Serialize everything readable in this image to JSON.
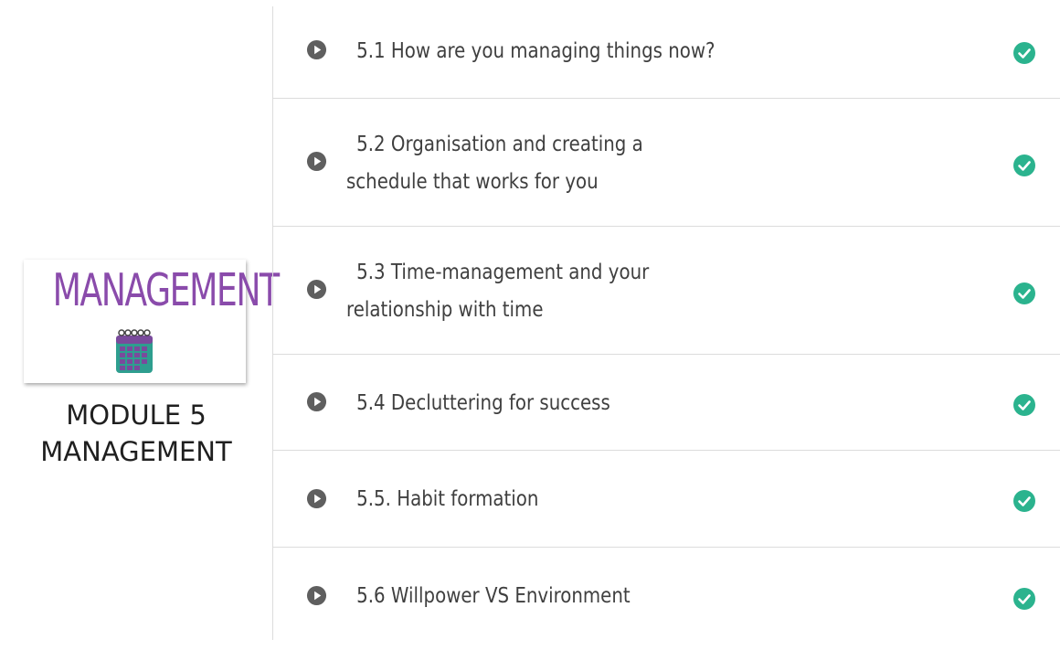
{
  "module": {
    "thumbnail_title": "MANAGEMENT",
    "caption_line1": "MODULE 5",
    "caption_line2": "MANAGEMENT",
    "icon": "calendar-icon"
  },
  "lessons": [
    {
      "title": "5.1 How are you managing things now?",
      "status": "complete",
      "icon": "play-circle-icon"
    },
    {
      "title": "5.2 Organisation and creating a schedule that works for you",
      "status": "complete",
      "icon": "play-circle-icon"
    },
    {
      "title": "5.3 Time-management and your relationship with time",
      "status": "complete",
      "icon": "play-circle-icon"
    },
    {
      "title": "5.4 Decluttering for success",
      "status": "complete",
      "icon": "play-circle-icon"
    },
    {
      "title": "5.5. Habit formation",
      "status": "complete",
      "icon": "play-circle-icon"
    },
    {
      "title": "5.6 Willpower VS Environment",
      "status": "complete",
      "icon": "play-circle-icon"
    }
  ],
  "colors": {
    "accent_purple": "#8a4bab",
    "check_green": "#2bb38e",
    "play_gray": "#5f5f5f",
    "divider": "#dcdcdc"
  }
}
